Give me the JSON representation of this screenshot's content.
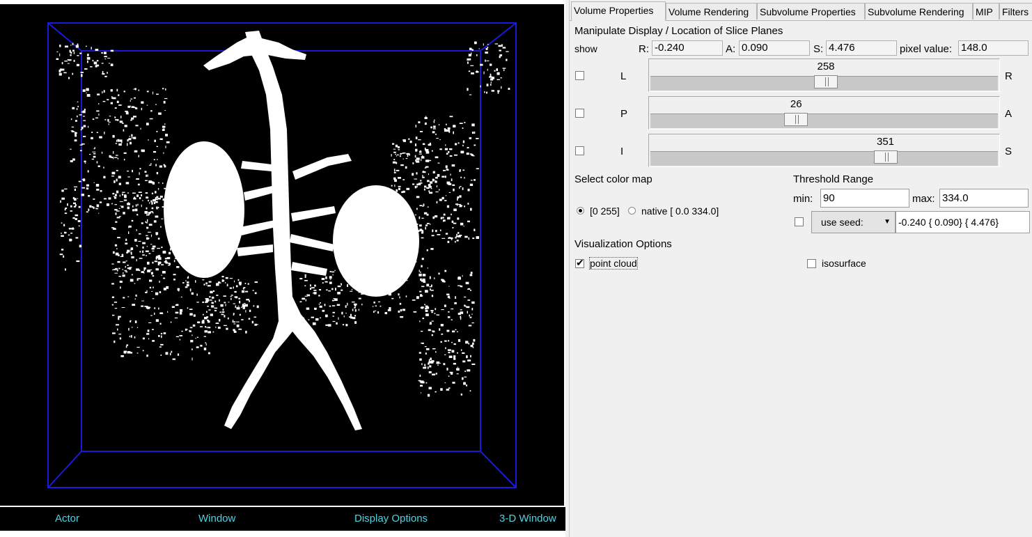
{
  "viewer": {
    "buttons": [
      "Actor",
      "Window",
      "Display Options",
      "3-D Window"
    ],
    "box_color": "#1a1adb",
    "label_color": "#4fd4e0"
  },
  "tabs": [
    "Volume Properties",
    "Volume Rendering",
    "Subvolume Properties",
    "Subvolume Rendering",
    "MIP",
    "Filters"
  ],
  "active_tab": "Volume Properties",
  "slice_planes": {
    "heading": "Manipulate Display / Location of Slice Planes",
    "show_label": "show",
    "r_label": "R:",
    "r_value": "-0.240",
    "a_label": "A:",
    "a_value": "0.090",
    "s_label": "S:",
    "s_value": "4.476",
    "pixel_label": "pixel value:",
    "pixel_value": "148.0",
    "sliders": [
      {
        "left": "L",
        "right": "R",
        "value": "258",
        "fraction": 0.505,
        "checked": false
      },
      {
        "left": "P",
        "right": "A",
        "value": "26",
        "fraction": 0.42,
        "checked": false
      },
      {
        "left": "I",
        "right": "S",
        "value": "351",
        "fraction": 0.675,
        "checked": false
      }
    ]
  },
  "color_map": {
    "heading": "Select color map",
    "option1": "[0 255]",
    "option2": "native [ 0.0 334.0]",
    "selected": "[0 255]"
  },
  "threshold": {
    "heading": "Threshold Range",
    "min_label": "min:",
    "min_value": "90",
    "max_label": "max:",
    "max_value": "334.0",
    "seed_label": "use seed:",
    "seed_value": "-0.240 { 0.090} { 4.476}"
  },
  "viz": {
    "heading": "Visualization Options",
    "point_cloud": "point cloud",
    "point_cloud_checked": true,
    "isosurface": "isosurface",
    "isosurface_checked": false
  }
}
